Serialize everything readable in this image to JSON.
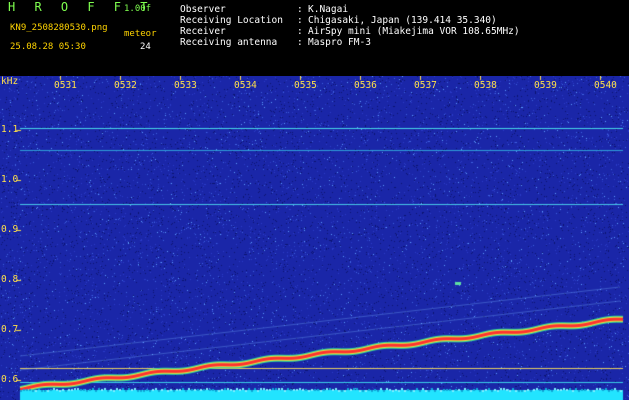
{
  "header": {
    "app_title": "H R O F F T",
    "version": "1.00f",
    "filename": "KN9_2508280530.png",
    "mode_label": "meteor",
    "mode_value": "24",
    "datetime": "25.08.28 05:30"
  },
  "info": [
    {
      "label": "Observer",
      "value": "K.Nagai"
    },
    {
      "label": "Receiving Location",
      "value": "Chigasaki, Japan (139.414 35.340)"
    },
    {
      "label": "Receiver",
      "value": "AirSpy mini (Miakejima VOR 108.65MHz)"
    },
    {
      "label": "Receiving antenna",
      "value": "Maspro FM-3"
    }
  ],
  "axis": {
    "y_unit": "kHz",
    "y_ticks": [
      "1.1",
      "1.0",
      "0.9",
      "0.8",
      "0.7",
      "0.6"
    ],
    "x_ticks": [
      "0531",
      "0532",
      "0533",
      "0534",
      "0535",
      "0536",
      "0537",
      "0538",
      "0539",
      "0540"
    ]
  },
  "colors": {
    "background": "#1a26a8",
    "trace": "#ff3030",
    "bottom_band": "#22e4ff",
    "label": "#ffe04a"
  }
}
